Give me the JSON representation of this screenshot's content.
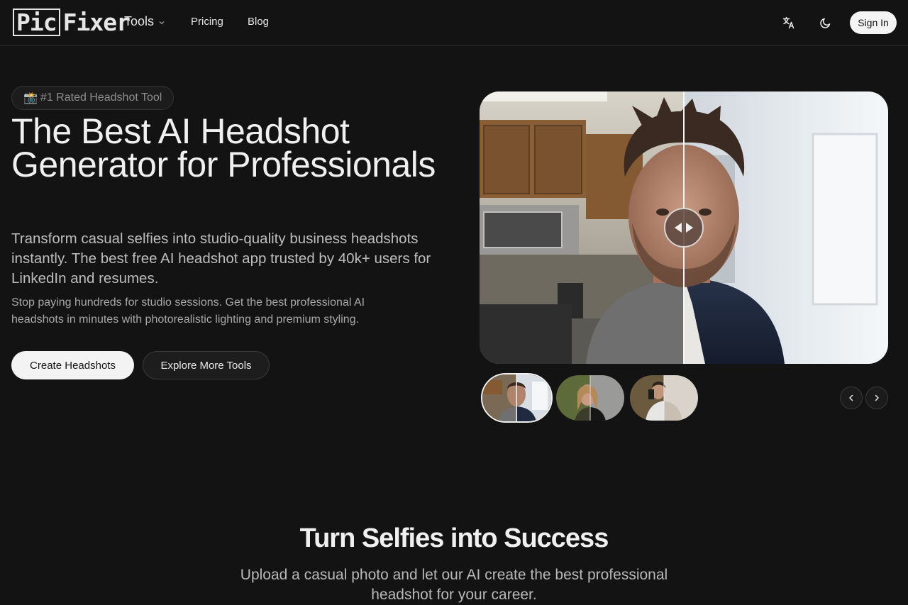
{
  "nav": {
    "logo_part1": "Pic",
    "logo_part2": "Fixer",
    "tools_label": "Tools",
    "pricing_label": "Pricing",
    "blog_label": "Blog",
    "translate_icon": "translate-icon",
    "theme_icon": "moon-icon",
    "signin_label": "Sign In"
  },
  "hero": {
    "badge_emoji": "📸",
    "badge_text": "#1 Rated Headshot Tool",
    "title": "The Best AI Headshot Generator for Professionals",
    "subtitle": "Transform casual selfies into studio-quality business headshots instantly. The best free AI headshot app trusted by 40k+ users for LinkedIn and resumes.",
    "description": "Stop paying hundreds for studio sessions. Get the best professional AI headshots in minutes with photorealistic lighting and premium styling.",
    "primary_cta": "Create Headshots",
    "secondary_cta": "Explore More Tools"
  },
  "carousel": {
    "active_index": 0,
    "slider_position": 0.5
  },
  "section": {
    "title": "Turn Selfies into Success",
    "subtitle": "Upload a casual photo and let our AI create the best professional headshot for your career."
  },
  "colors": {
    "background": "#131313",
    "text": "#ececec",
    "button_light": "#f3f3f3"
  }
}
